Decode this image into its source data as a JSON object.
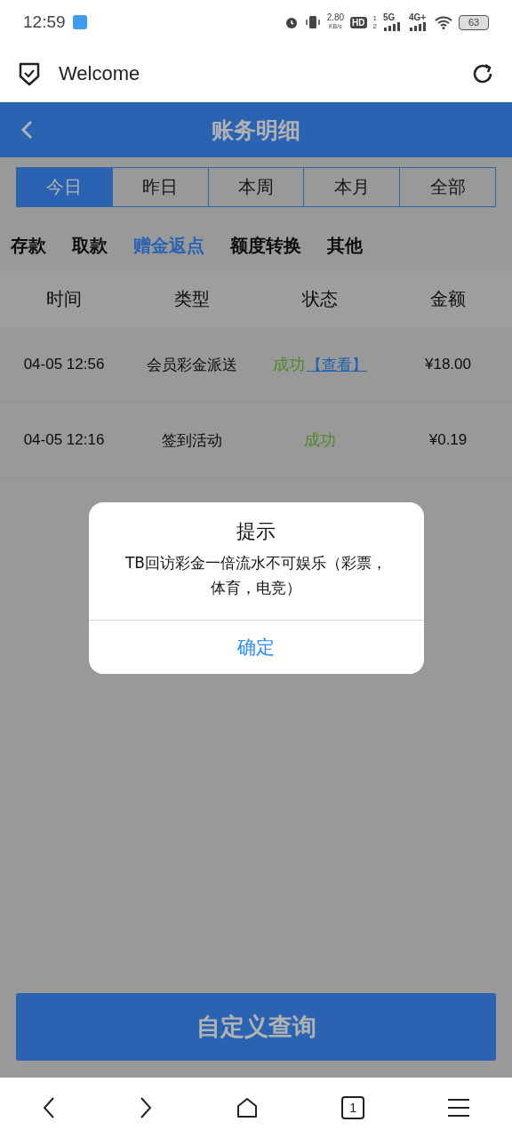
{
  "status_bar": {
    "time": "12:59",
    "speed": "2.80",
    "speed_unit": "KB/s",
    "hd": "HD",
    "sim_marks": [
      "1",
      "2"
    ],
    "net_1": "5G",
    "net_2": "4G+",
    "battery": "63"
  },
  "browser_bar": {
    "title": "Welcome"
  },
  "header": {
    "title": "账务明细"
  },
  "period_tabs": [
    {
      "label": "今日",
      "selected": true
    },
    {
      "label": "昨日",
      "selected": false
    },
    {
      "label": "本周",
      "selected": false
    },
    {
      "label": "本月",
      "selected": false
    },
    {
      "label": "全部",
      "selected": false
    }
  ],
  "category_tabs": [
    {
      "label": "存款",
      "selected": false
    },
    {
      "label": "取款",
      "selected": false
    },
    {
      "label": "赠金返点",
      "selected": true
    },
    {
      "label": "额度转换",
      "selected": false
    },
    {
      "label": "其他",
      "selected": false
    }
  ],
  "table": {
    "columns": [
      "时间",
      "类型",
      "状态",
      "金额"
    ],
    "rows": [
      {
        "time": "04-05 12:56",
        "type": "会员彩金派送",
        "status": "成功",
        "link": "【查看】",
        "amount": "¥18.00"
      },
      {
        "time": "04-05 12:16",
        "type": "签到活动",
        "status": "成功",
        "amount": "¥0.19"
      }
    ]
  },
  "query_button": "自定义查询",
  "dialog": {
    "title": "提示",
    "message": "TB回访彩金一倍流水不可娱乐（彩票，体育，电竞）",
    "confirm": "确定"
  },
  "nav_bar": {
    "tab_count": "1"
  }
}
